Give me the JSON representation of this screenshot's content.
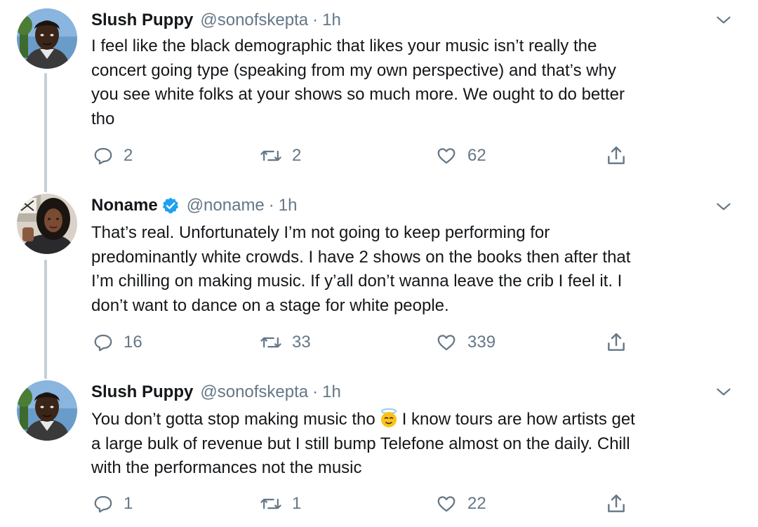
{
  "tweets": [
    {
      "name": "Slush Puppy",
      "handle": "@sonofskepta",
      "dot": "·",
      "time": "1h",
      "verified": false,
      "avatar_icon": "profile-photo-slush-puppy",
      "text_lines": [
        "I feel like the black demographic that likes your music isn’t really the",
        "concert going type (speaking from my own perspective) and that’s why",
        "you see white folks at your shows so much more. We ought to do better",
        "tho"
      ],
      "reply_count": "2",
      "retweet_count": "2",
      "like_count": "62"
    },
    {
      "name": "Noname",
      "handle": "@noname",
      "dot": "·",
      "time": "1h",
      "verified": true,
      "avatar_icon": "profile-photo-noname",
      "text_lines": [
        "That’s real. Unfortunately I’m not going to keep performing for",
        "predominantly white crowds. I have 2 shows on the books then after that",
        "I’m chilling on making music. If y’all don’t wanna leave the crib I feel it. I",
        "don’t want to dance on a stage for white people."
      ],
      "reply_count": "16",
      "retweet_count": "33",
      "like_count": "339"
    },
    {
      "name": "Slush Puppy",
      "handle": "@sonofskepta",
      "dot": "·",
      "time": "1h",
      "verified": false,
      "avatar_icon": "profile-photo-slush-puppy",
      "text_line1_before_emoji": "You don’t gotta stop making music tho",
      "emoji": "innocent-face-emoji",
      "text_line1_after_emoji": "I know tours are how artists get",
      "text_lines_rest": [
        "a large bulk of revenue but I still bump Telefone almost on the daily. Chill",
        "with the performances not the music"
      ],
      "reply_count": "1",
      "retweet_count": "1",
      "like_count": "22"
    }
  ],
  "icons": {
    "reply": "reply-icon",
    "retweet": "retweet-icon",
    "like": "heart-icon",
    "share": "share-icon",
    "caret": "chevron-down-icon",
    "verified": "verified-badge-icon"
  },
  "colors": {
    "text": "#14171a",
    "secondary": "#657786",
    "verified": "#1da1f2",
    "thread_line": "#c4cfd6"
  }
}
